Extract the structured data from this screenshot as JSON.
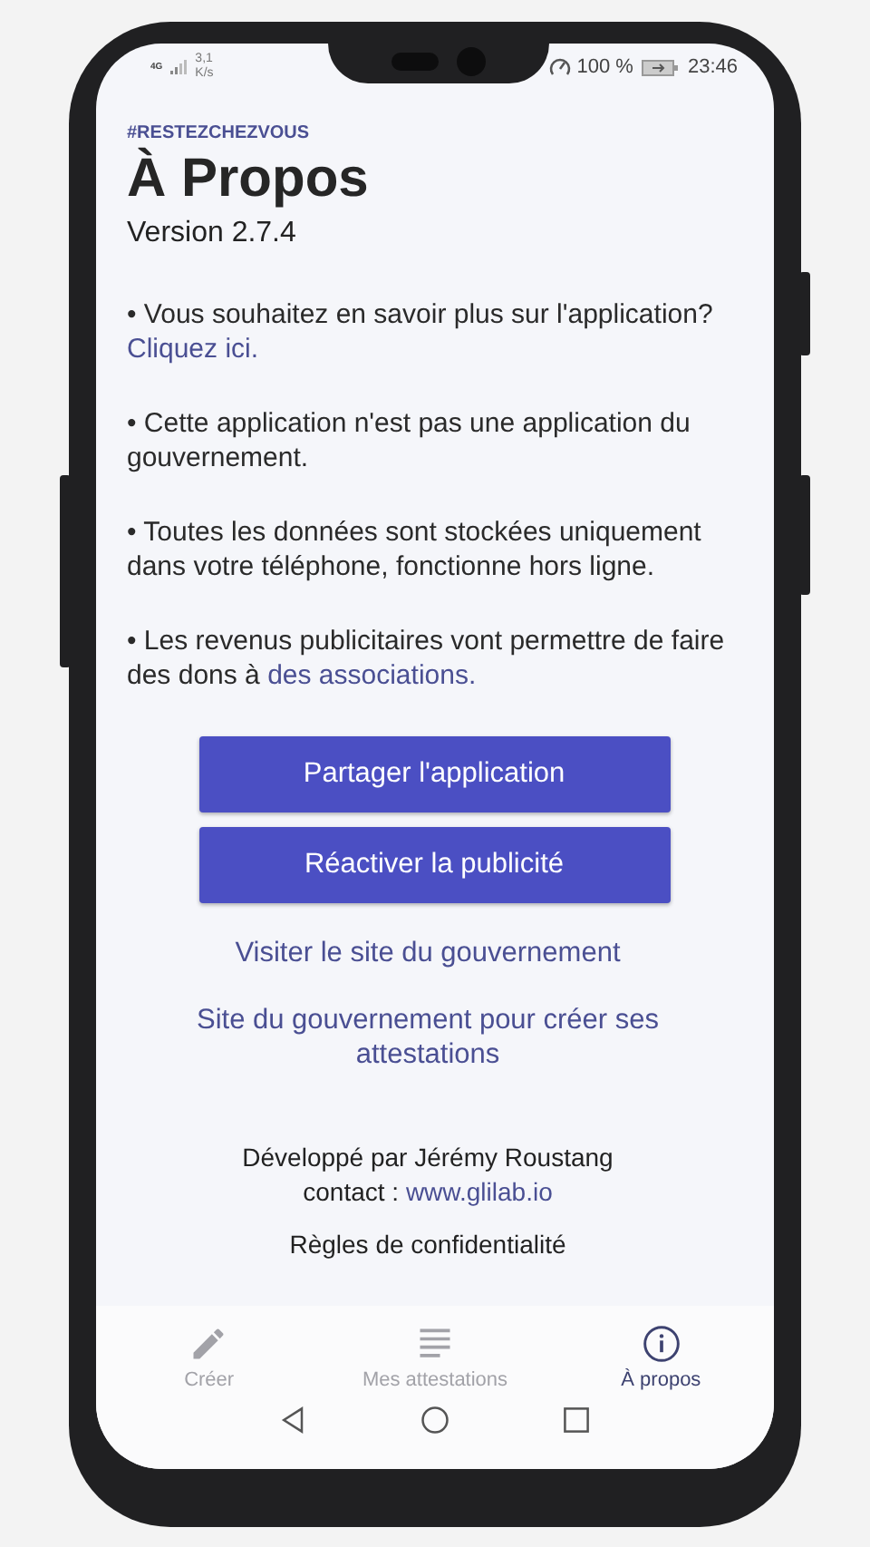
{
  "status_bar": {
    "network": "4G",
    "speed_value": "3,1",
    "speed_unit": "K/s",
    "battery": "100 %",
    "time": "23:46"
  },
  "header": {
    "hashtag": "#RESTEZCHEZVOUS",
    "title": "À Propos",
    "version": "Version 2.7.4"
  },
  "paragraphs": [
    {
      "text": "• Vous souhaitez en savoir plus sur l'application?",
      "link": "Cliquez ici."
    },
    {
      "text": "• Cette application n'est pas une application du gouvernement."
    },
    {
      "text": "• Toutes les données sont stockées uniquement dans votre téléphone, fonctionne hors ligne."
    },
    {
      "text": "• Les revenus publicitaires vont permettre de faire des dons à",
      "link": "des associations."
    }
  ],
  "buttons": [
    "Partager l'application",
    "Réactiver la publicité"
  ],
  "links": [
    "Visiter le site du gouvernement",
    "Site du gouvernement pour créer ses attestations"
  ],
  "footer": {
    "developer": "Développé par Jérémy Roustang",
    "contact_label": "contact :",
    "contact_link": "www.glilab.io",
    "privacy": "Règles de confidentialité"
  },
  "tabs": [
    {
      "label": "Créer",
      "kind": "pencil",
      "selected": false
    },
    {
      "label": "Mes attestations",
      "kind": "list",
      "selected": false
    },
    {
      "label": "À propos",
      "kind": "info",
      "selected": true
    }
  ]
}
